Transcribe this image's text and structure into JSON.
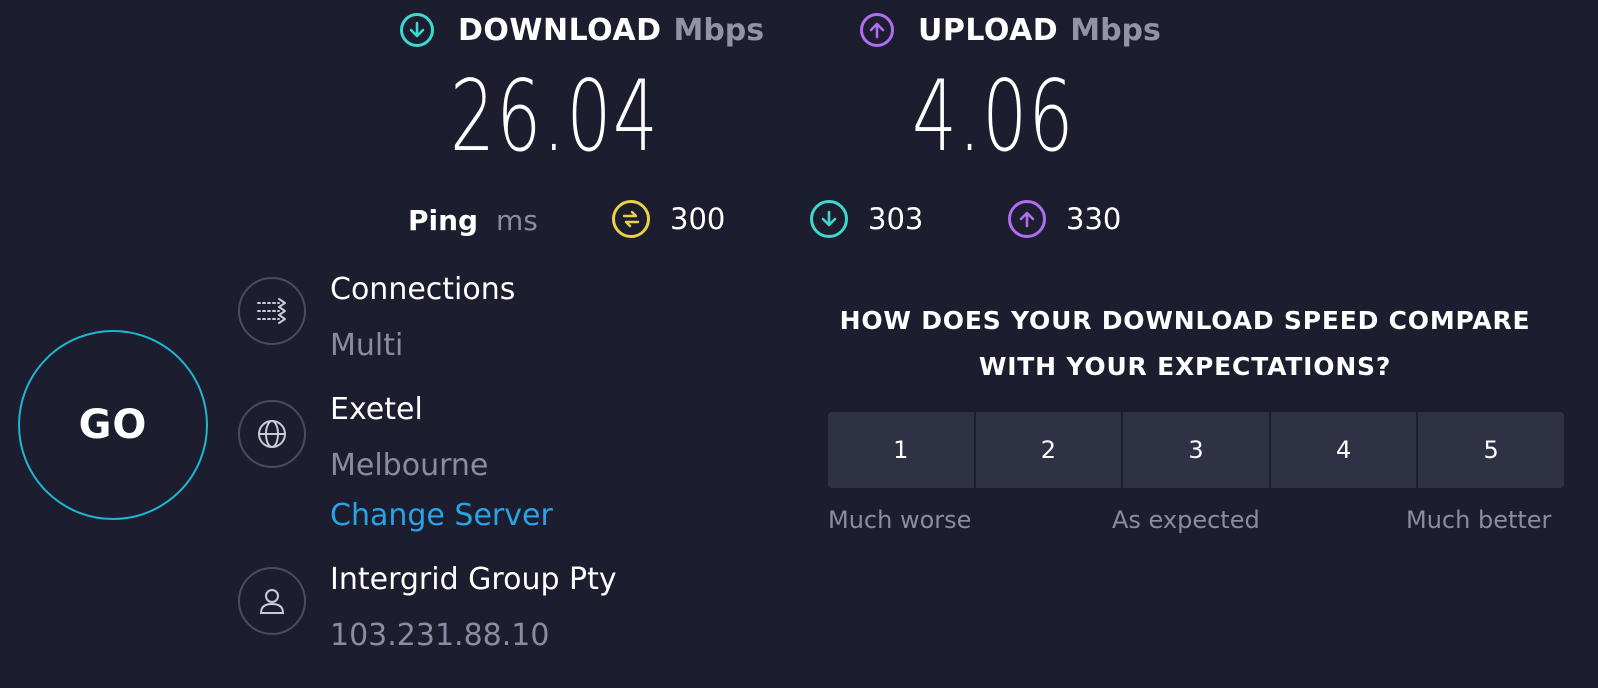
{
  "download": {
    "title": "DOWNLOAD",
    "unit": "Mbps",
    "value": "26.04",
    "icon": "arrow-down-circle-icon",
    "color": "#3fd8cf"
  },
  "upload": {
    "title": "UPLOAD",
    "unit": "Mbps",
    "value": "4.06",
    "icon": "arrow-up-circle-icon",
    "color": "#b06ef0"
  },
  "ping": {
    "label": "Ping",
    "unit": "ms",
    "idle": {
      "value": "300",
      "icon": "ping-idle-icon",
      "color": "#e8d24a"
    },
    "download": {
      "value": "303",
      "icon": "arrow-down-circle-icon",
      "color": "#3fd8cf"
    },
    "upload": {
      "value": "330",
      "icon": "arrow-up-circle-icon",
      "color": "#b06ef0"
    }
  },
  "go_button": {
    "label": "GO",
    "color": "#1fb6d0"
  },
  "connections": {
    "title": "Connections",
    "value": "Multi",
    "icon": "connections-icon"
  },
  "server": {
    "title": "Exetel",
    "location": "Melbourne",
    "change_link": "Change Server",
    "icon": "globe-icon",
    "link_color": "#2aa3e6"
  },
  "provider": {
    "title": "Intergrid Group Pty",
    "ip": "103.231.88.10",
    "icon": "user-icon"
  },
  "survey": {
    "question_line1": "HOW DOES YOUR DOWNLOAD SPEED COMPARE",
    "question_line2": "WITH YOUR EXPECTATIONS?",
    "options": [
      "1",
      "2",
      "3",
      "4",
      "5"
    ],
    "caption_low": "Much worse",
    "caption_mid": "As expected",
    "caption_high": "Much better"
  }
}
